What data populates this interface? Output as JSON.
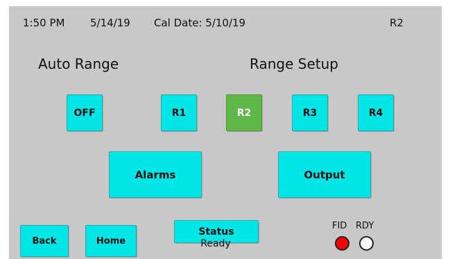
{
  "status_bar": {
    "time": "1:50 PM",
    "date": "5/14/19",
    "cal_date": "Cal Date: 5/10/19",
    "current_range": "R2"
  },
  "headings": {
    "auto_range": "Auto Range",
    "range_setup": "Range Setup"
  },
  "buttons": {
    "off": "OFF",
    "r1": "R1",
    "r2": "R2",
    "r3": "R3",
    "r4": "R4",
    "alarms": "Alarms",
    "output": "Output",
    "back": "Back",
    "home": "Home",
    "status": "Status"
  },
  "status": {
    "value": "Ready"
  },
  "indicators": {
    "fid_label": "FID",
    "rdy_label": "RDY",
    "fid_color": "#ff0000",
    "rdy_color": "#ffffff"
  },
  "colors": {
    "button": "#00e5e5",
    "active_button": "#5fb747",
    "screen_background": "#c8c8c8"
  }
}
